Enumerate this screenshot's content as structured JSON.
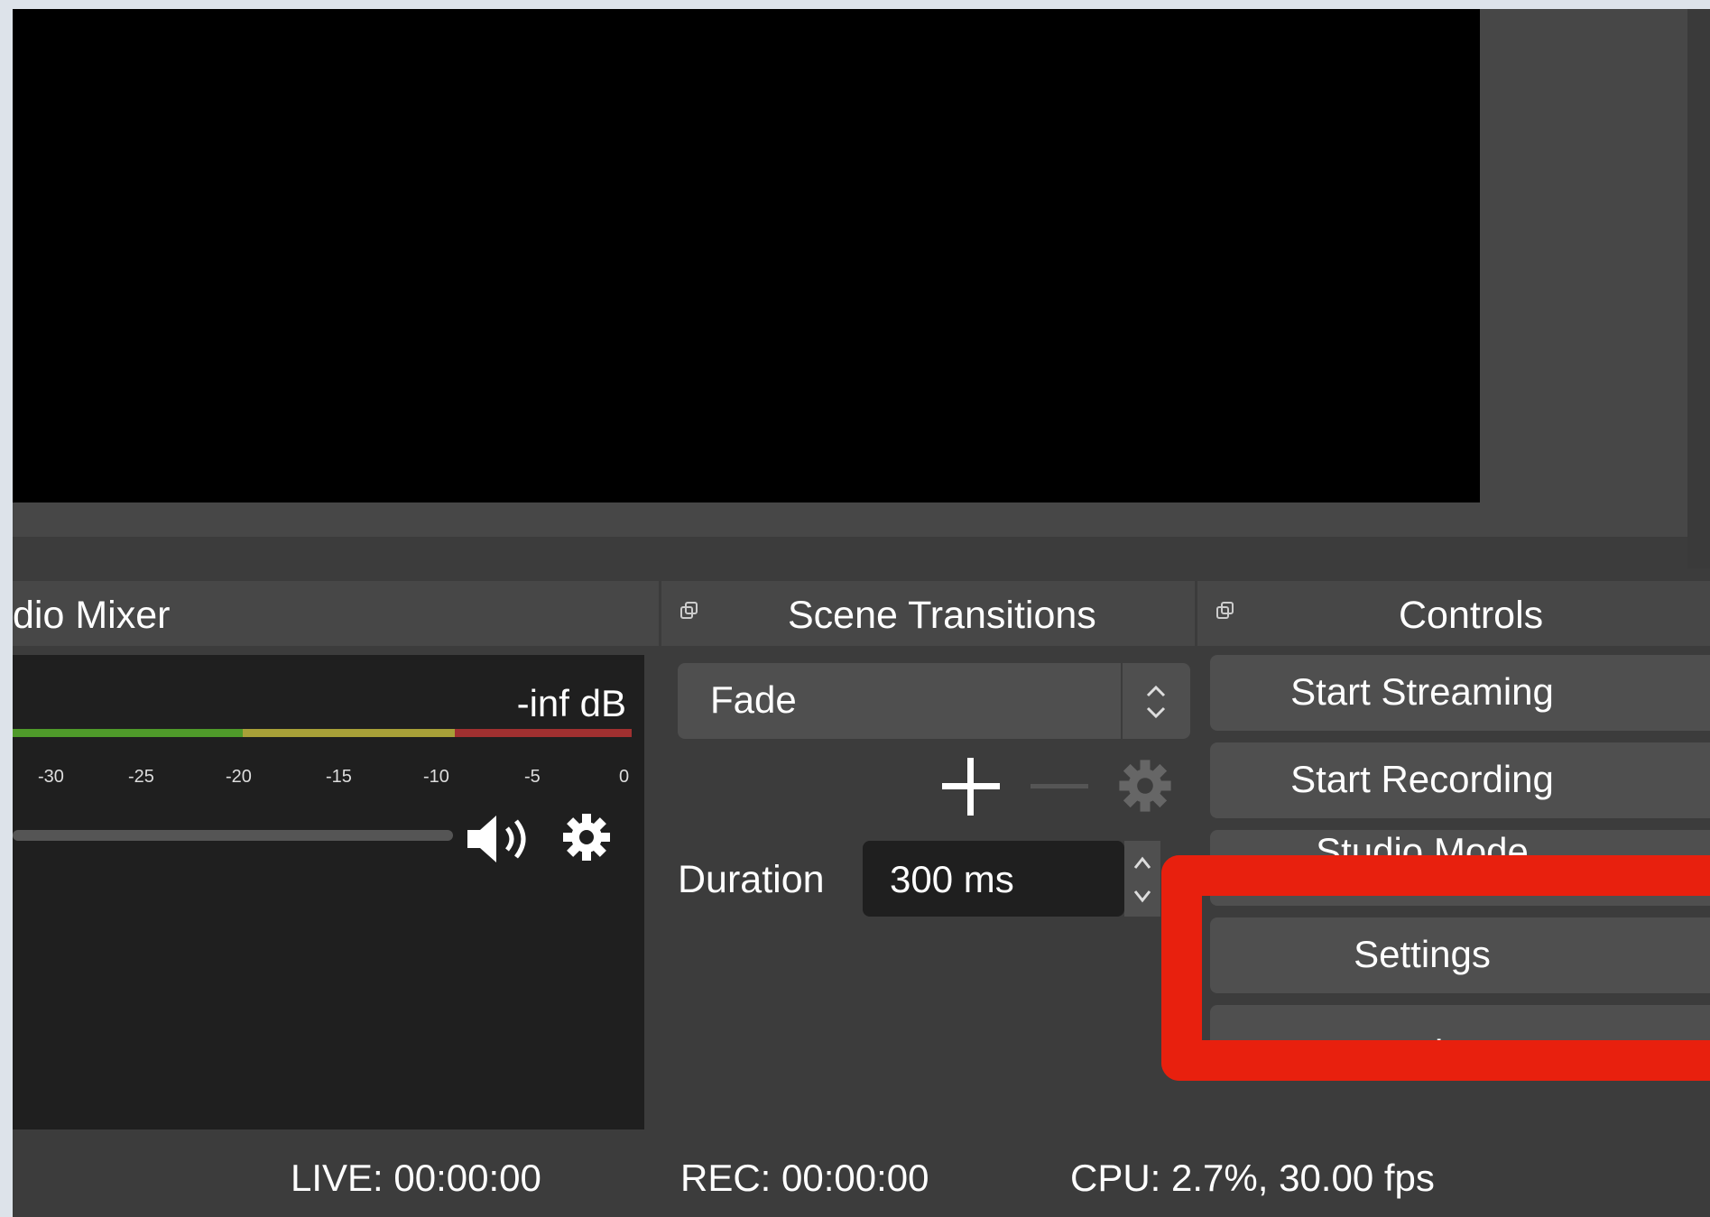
{
  "audio_mixer": {
    "title": "dio Mixer",
    "level": "-inf dB",
    "ticks": [
      "-30",
      "-25",
      "-20",
      "-15",
      "-10",
      "-5",
      "0"
    ]
  },
  "scene_transitions": {
    "title": "Scene Transitions",
    "transition": "Fade",
    "duration_label": "Duration",
    "duration_value": "300 ms"
  },
  "controls": {
    "title": "Controls",
    "start_streaming": "Start Streaming",
    "start_recording": "Start Recording",
    "studio_mode": "Studio Mode",
    "settings": "Settings",
    "exit": "Exit"
  },
  "status": {
    "live": "LIVE: 00:00:00",
    "rec": "REC: 00:00:00",
    "cpu": "CPU: 2.7%, 30.00 fps"
  },
  "colors": {
    "highlight": "#e8200e",
    "meter_green": "#4f9a2a",
    "meter_yellow": "#a8a038",
    "meter_red": "#a03030"
  },
  "icons": [
    "float-icon",
    "speaker-icon",
    "gear-icon",
    "plus-icon",
    "minus-icon",
    "spinner-icon"
  ]
}
